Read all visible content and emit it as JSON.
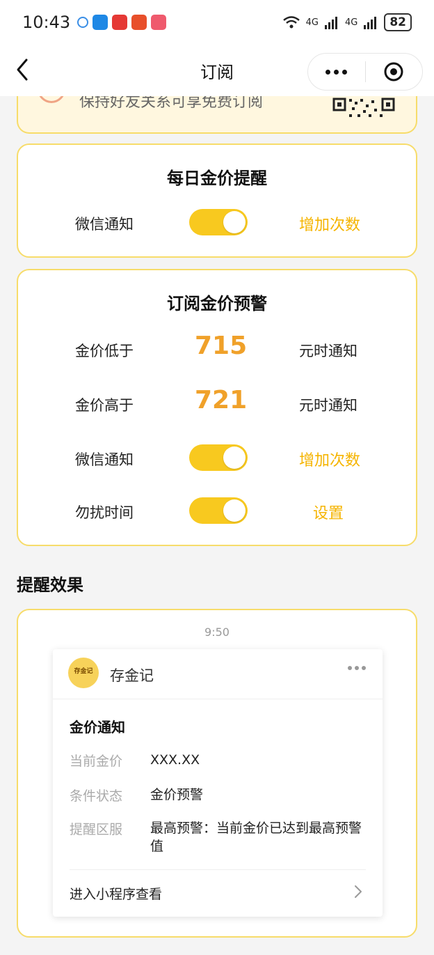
{
  "status": {
    "time": "10:43",
    "network_1": "4G",
    "network_2": "4G",
    "battery": "82"
  },
  "nav": {
    "title": "订阅"
  },
  "promo": {
    "text": "保持好友关系可享免费订阅"
  },
  "daily": {
    "title": "每日金价提醒",
    "wechat_label": "微信通知",
    "wechat_on": true,
    "increase_label": "增加次数"
  },
  "alert": {
    "title": "订阅金价预警",
    "low_label": "金价低于",
    "low_value": "715",
    "low_suffix": "元时通知",
    "high_label": "金价高于",
    "high_value": "721",
    "high_suffix": "元时通知",
    "wechat_label": "微信通知",
    "wechat_on": true,
    "increase_label": "增加次数",
    "dnd_label": "勿扰时间",
    "dnd_on": true,
    "settings_label": "设置"
  },
  "effect": {
    "heading": "提醒效果",
    "time": "9:50",
    "brand": "存金记",
    "avatar_text": "存金记",
    "msg_title": "金价通知",
    "rows": [
      {
        "key": "当前金价",
        "value": "XXX.XX"
      },
      {
        "key": "条件状态",
        "value": "金价预警"
      },
      {
        "key": "提醒区服",
        "value": "最高预警：当前金价已达到最高预警值"
      }
    ],
    "footer_link": "进入小程序查看"
  },
  "colors": {
    "accent": "#f5b400",
    "toggle": "#f8c91f",
    "card_border": "#f7dc6a",
    "value": "#f0a12a"
  }
}
